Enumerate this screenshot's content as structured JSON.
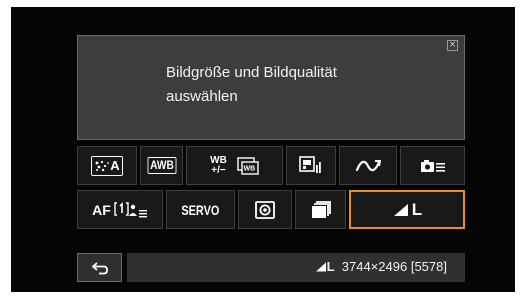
{
  "tip": {
    "text_line1": "Bildgröße und Bildqualität",
    "text_line2": "auswählen",
    "close_glyph": "×"
  },
  "row1": [
    {
      "name": "picture-style-auto",
      "label": "A",
      "icon": "picture-style-icon"
    },
    {
      "name": "white-balance",
      "label": "AWB"
    },
    {
      "name": "wb-shift-bracket",
      "label_top": "WB",
      "label_bottom": "+/−",
      "icon": "wb-bracket-icon"
    },
    {
      "name": "image-quality-settings",
      "icon": "image-settings-icon"
    },
    {
      "name": "auto-lighting-optimizer",
      "icon": "curve-icon"
    },
    {
      "name": "camera-settings-menu",
      "icon": "camera-menu-icon"
    }
  ],
  "row2": [
    {
      "name": "af-operation",
      "label": "AF"
    },
    {
      "name": "servo-mode",
      "label": "SERVO"
    },
    {
      "name": "metering-mode",
      "icon": "metering-icon"
    },
    {
      "name": "drive-mode",
      "icon": "drive-mode-icon"
    },
    {
      "name": "image-quality",
      "label": "L",
      "icon": "fine-quality-icon",
      "selected": true
    }
  ],
  "info": {
    "quality_label": "L",
    "resolution": "3744×2496",
    "shots": "[5578]"
  },
  "colors": {
    "screen_bg": "#050505",
    "tip_bg": "#3d3d3d",
    "cell_bg": "#191919",
    "selected_border": "#e88f1e",
    "info_bg": "#303030"
  }
}
